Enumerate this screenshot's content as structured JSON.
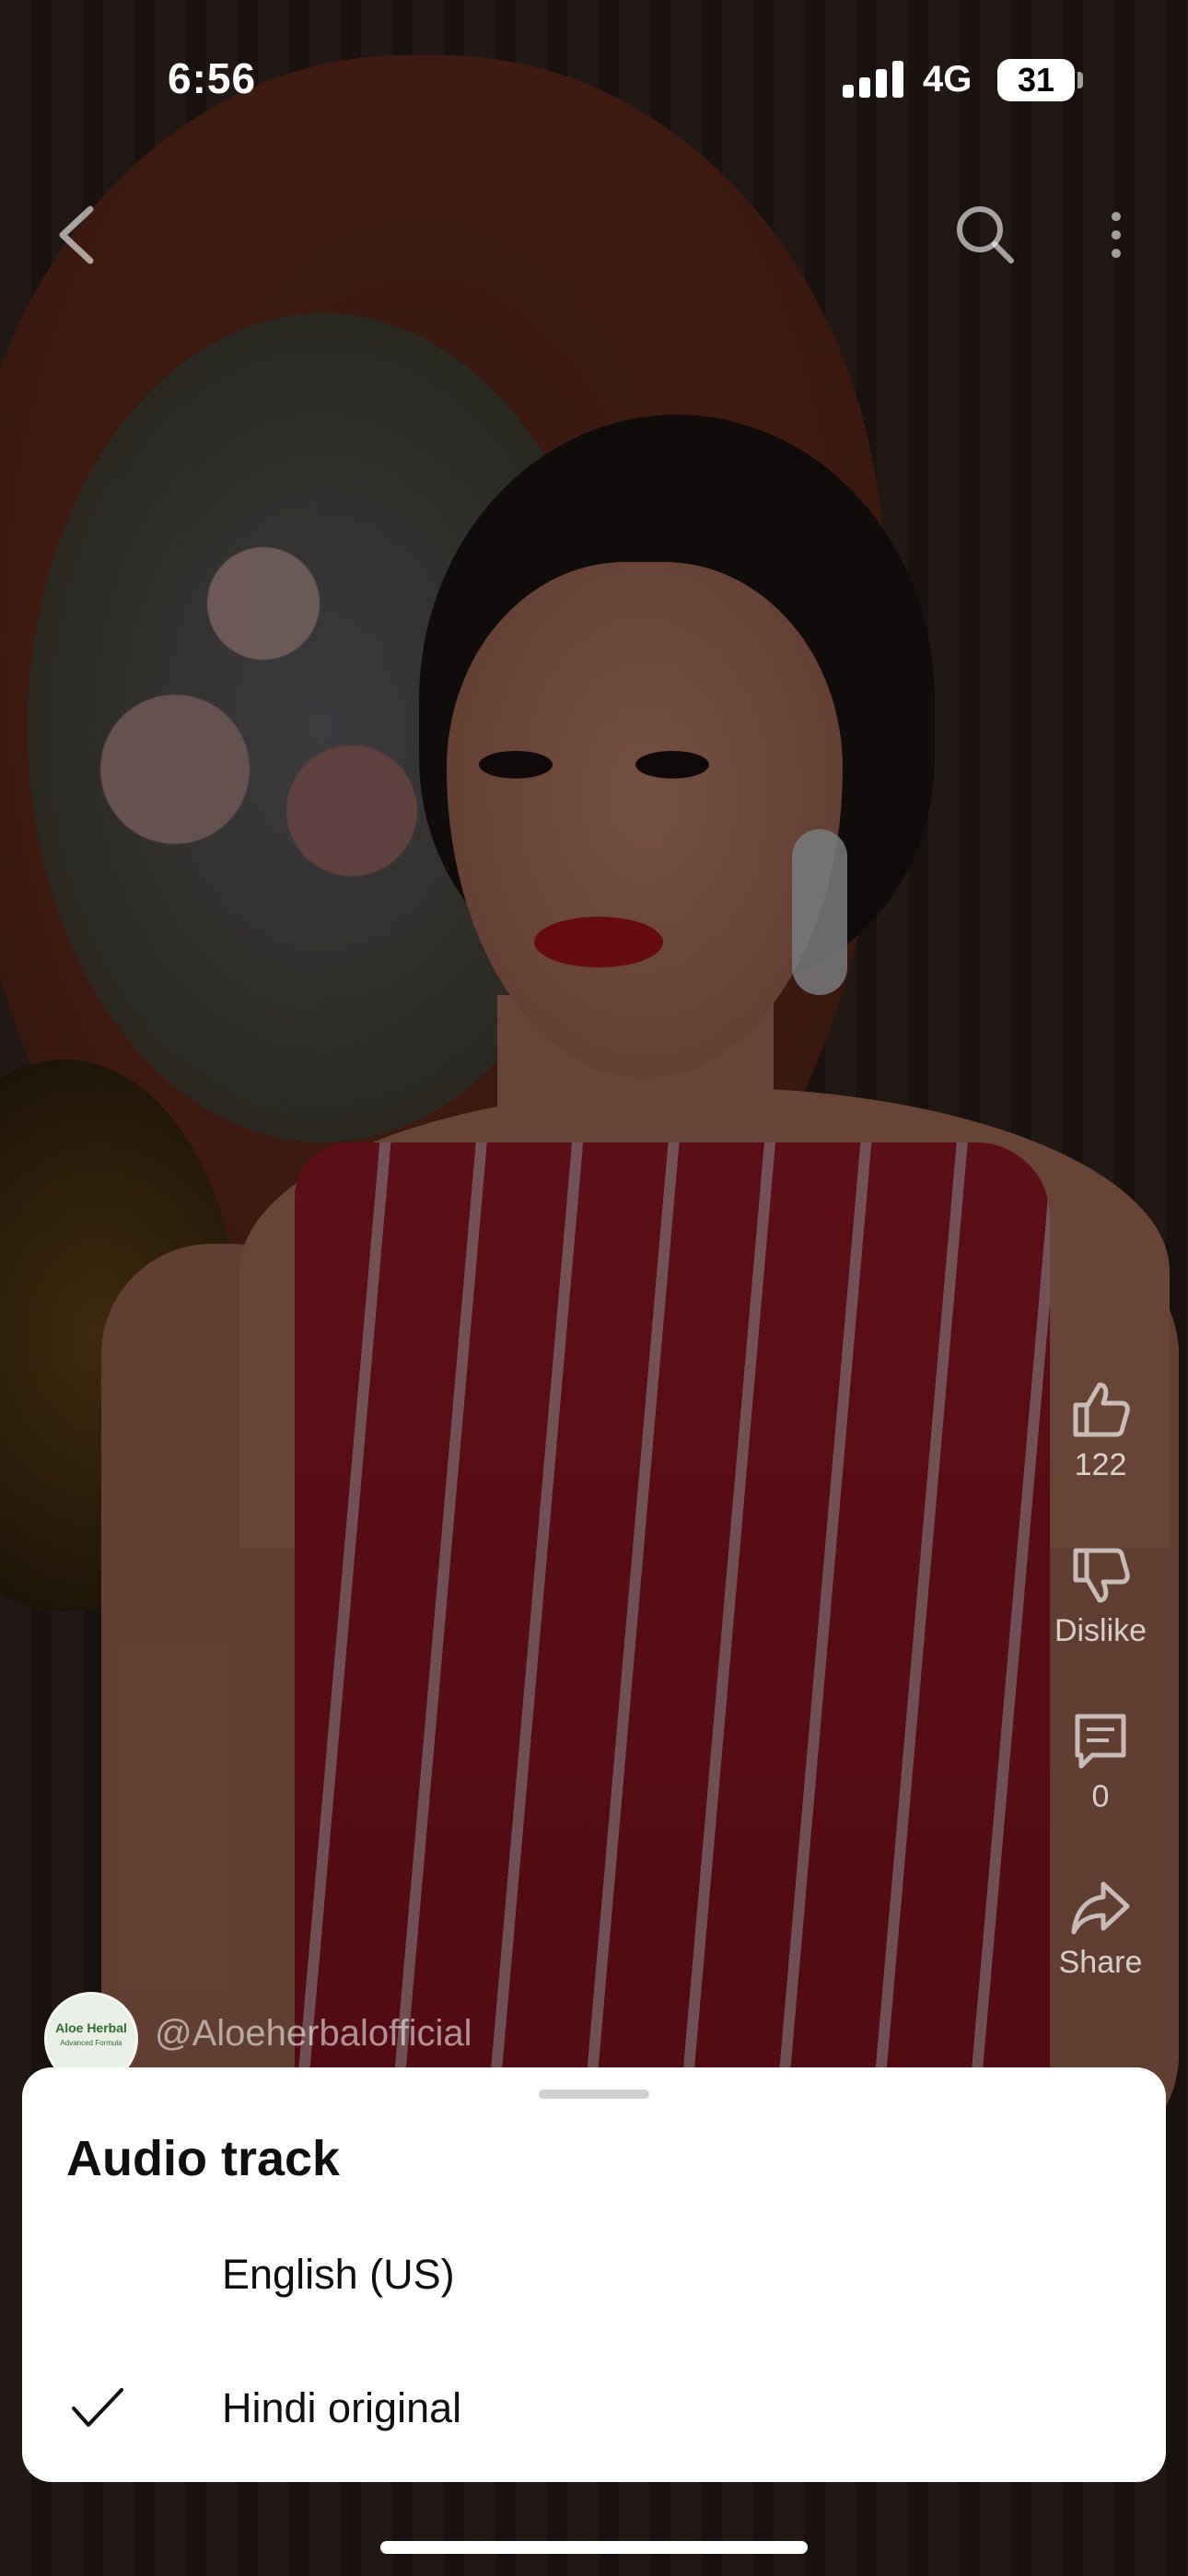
{
  "status_bar": {
    "time": "6:56",
    "network": "4G",
    "battery": "31"
  },
  "top_nav": {
    "back_icon": "chevron-left-icon",
    "search_icon": "search-icon",
    "more_icon": "more-vertical-icon"
  },
  "actions": {
    "like_count": "122",
    "dislike_label": "Dislike",
    "comment_count": "0",
    "share_label": "Share"
  },
  "channel": {
    "handle": "@Aloeherbalofficial",
    "avatar_text": "Aloe Herbal",
    "avatar_subtext": "Advanced Formula"
  },
  "audio_sheet": {
    "title": "Audio track",
    "options": [
      {
        "label": "English (US)",
        "selected": false
      },
      {
        "label": "Hindi original",
        "selected": true
      }
    ]
  },
  "colors": {
    "sheet_bg": "#ffffff",
    "text_primary": "#0f0f0f",
    "overlay": "rgba(0,0,0,0.42)"
  }
}
